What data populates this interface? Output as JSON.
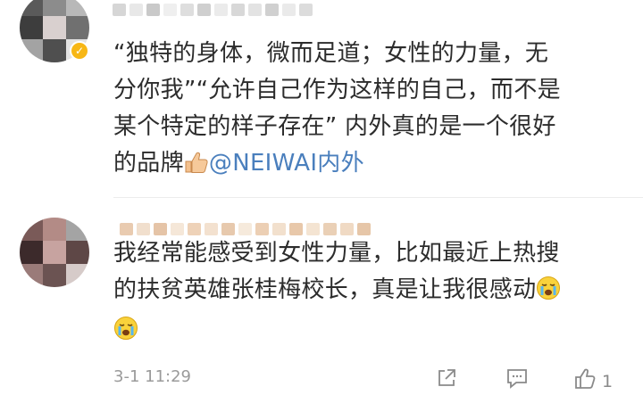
{
  "colors": {
    "text": "#2c2c2c",
    "mention": "#4a7fbd",
    "meta": "#9a9a9a",
    "verified_badge": "#f7b716"
  },
  "comments": [
    {
      "line1": "“独特的身体，微而足道；女性的力量，无",
      "line2": "分你我”“允许自己作为这样的自己，而不是",
      "line3": "某个特定的样子存在” 内外真的是一个很好",
      "line4_a": "的品牌",
      "line4_mention": "@NEIWAI内外",
      "emoji": "thumbs-up-icon",
      "verified": true
    },
    {
      "line1": "我经常能感受到女性力量，比如最近上热搜",
      "line2": "的扶贫英雄张桂梅校长，真是让我很感动",
      "emoji": "crying-face-icon",
      "timestamp": "3-1 11:29",
      "like_count": "1",
      "actions": [
        "share-icon",
        "reply-icon",
        "like-icon"
      ]
    }
  ]
}
